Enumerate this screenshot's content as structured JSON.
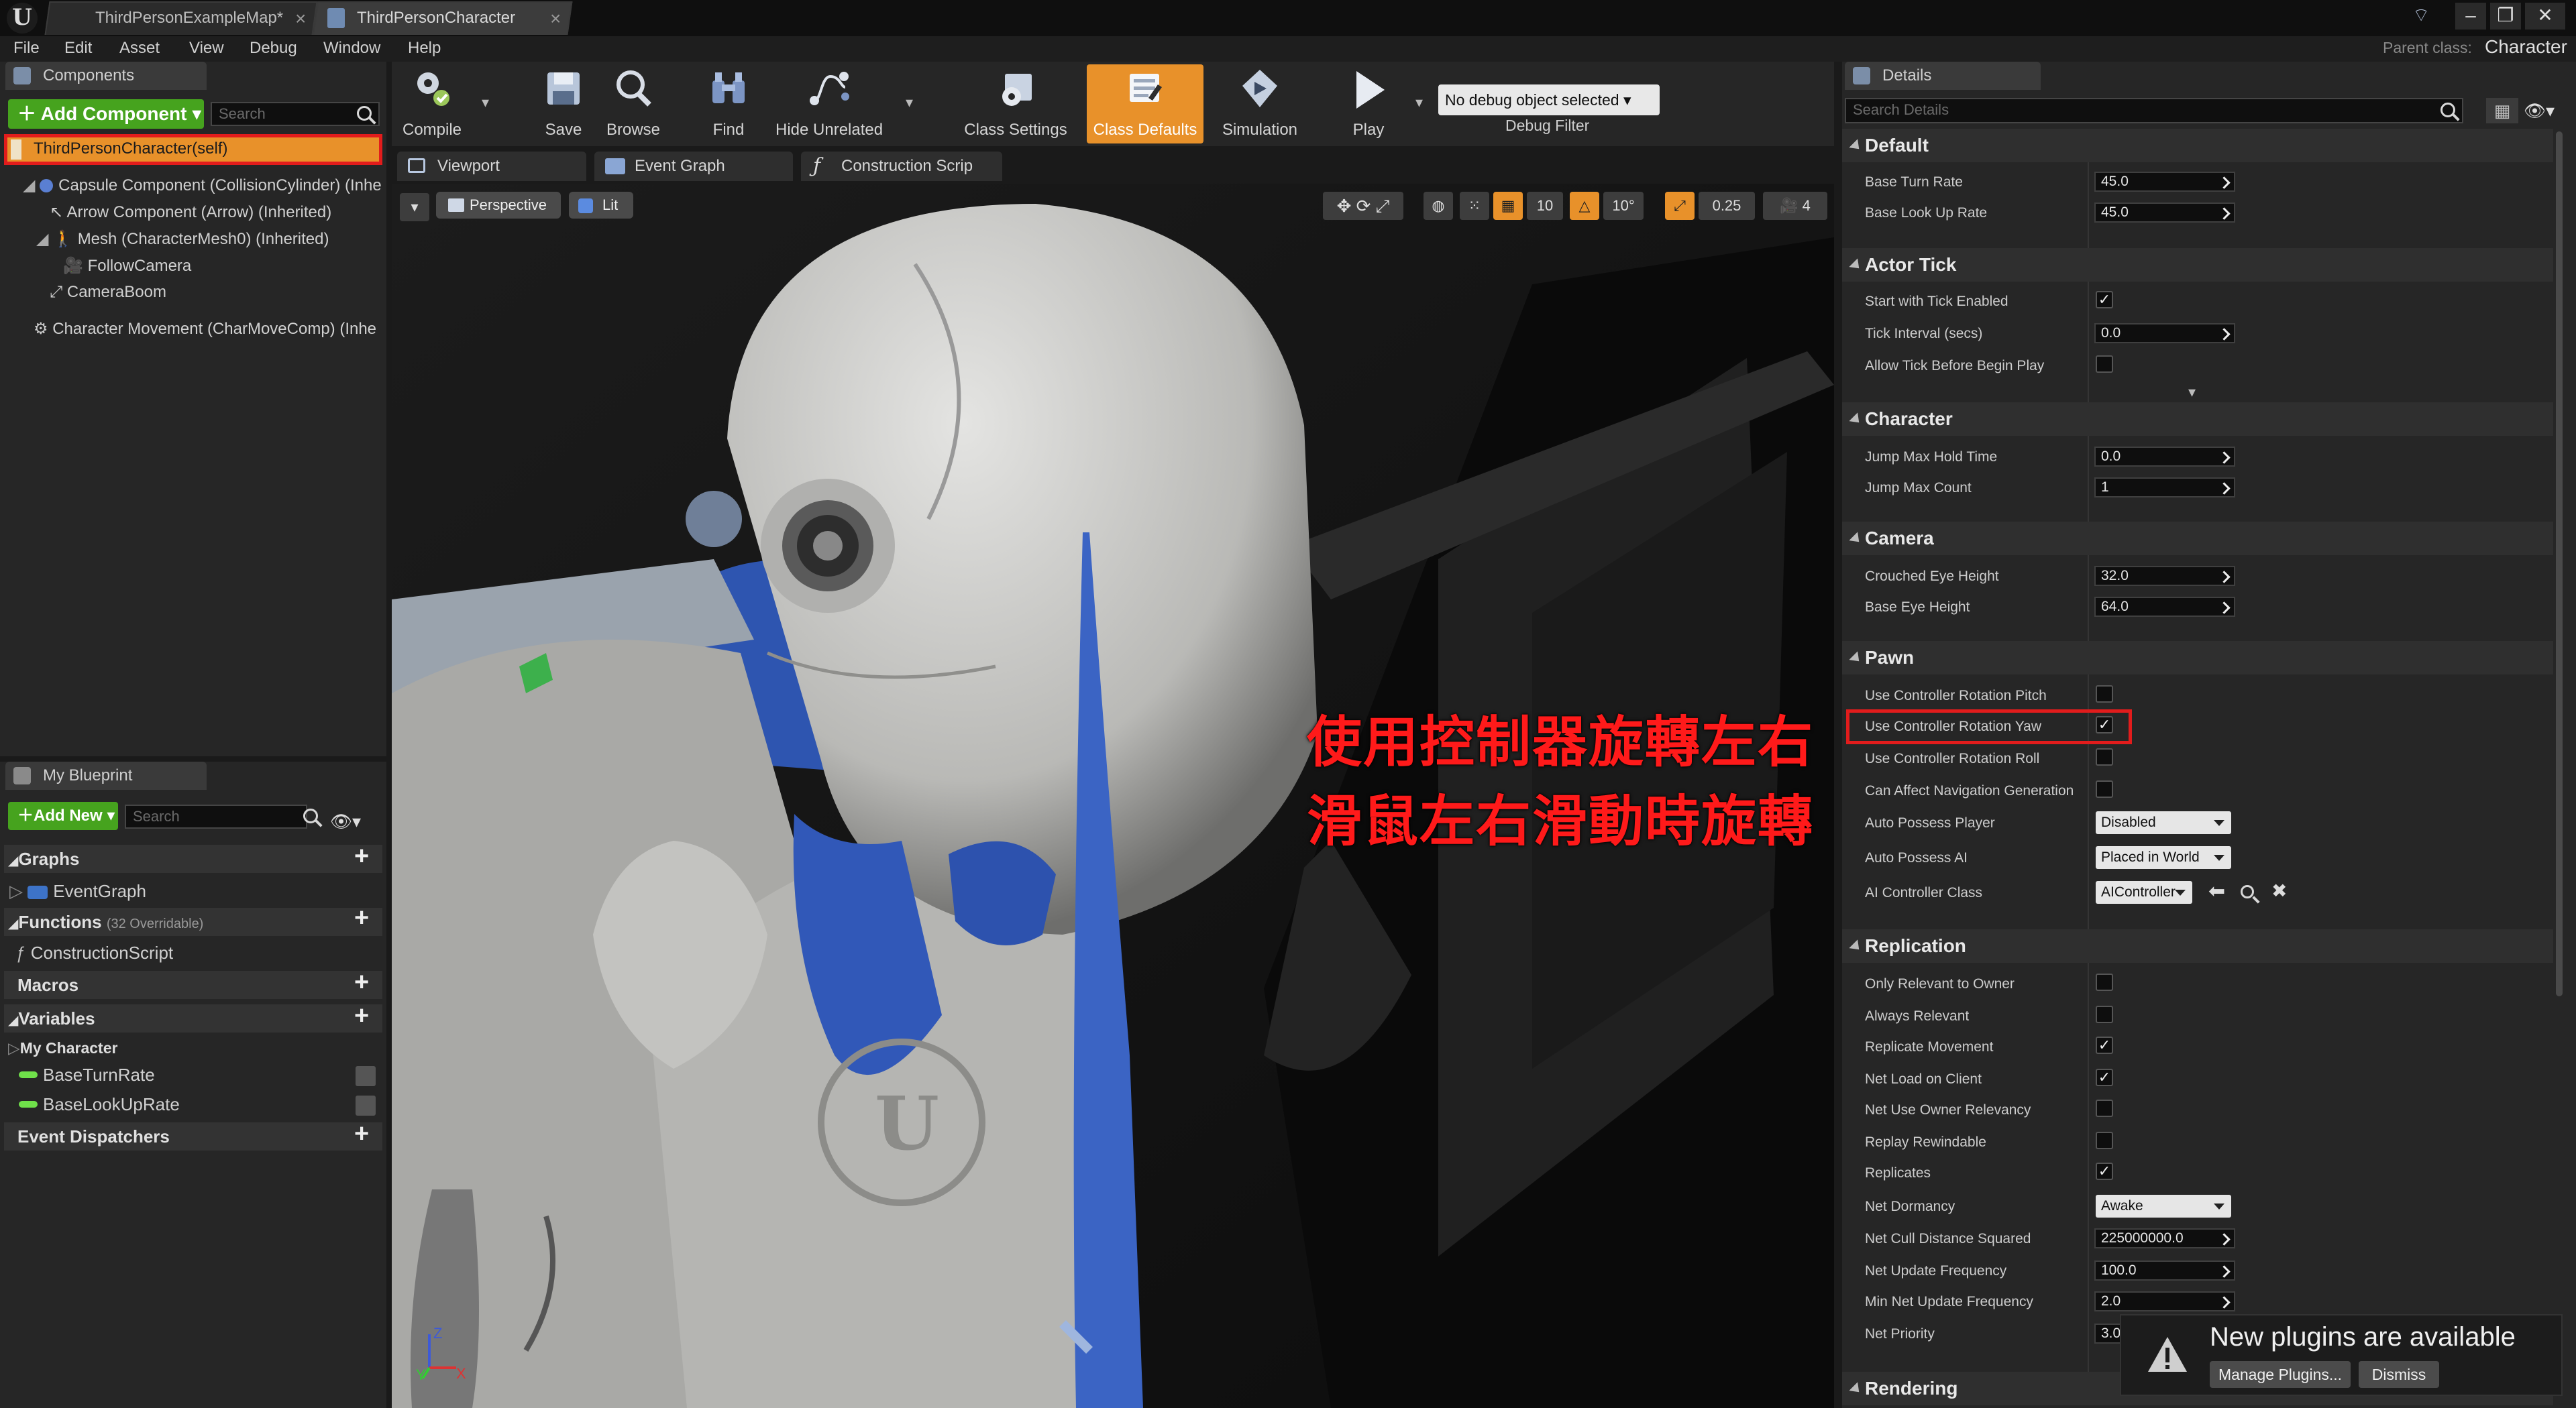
{
  "window": {
    "tabs": [
      "ThirdPersonExampleMap*",
      "ThirdPersonCharacter"
    ],
    "parent_class_label": "Parent class:",
    "parent_class_value": "Character"
  },
  "menu": [
    "File",
    "Edit",
    "Asset",
    "View",
    "Debug",
    "Window",
    "Help"
  ],
  "components": {
    "tab": "Components",
    "add_button": "Add Component",
    "search_placeholder": "Search",
    "items": [
      "ThirdPersonCharacter(self)",
      "Capsule Component (CollisionCylinder) (Inhe",
      "Arrow Component (Arrow) (Inherited)",
      "Mesh (CharacterMesh0) (Inherited)",
      "FollowCamera",
      "CameraBoom",
      "Character Movement (CharMoveComp) (Inhe"
    ]
  },
  "my_blueprint": {
    "tab": "My Blueprint",
    "add_button": "Add New",
    "search_placeholder": "Search",
    "graphs_label": "Graphs",
    "graph_item": "EventGraph",
    "functions_label": "Functions",
    "functions_note": "(32 Overridable)",
    "function_item": "ConstructionScript",
    "macros_label": "Macros",
    "variables_label": "Variables",
    "var_group": "My Character",
    "variables": [
      "BaseTurnRate",
      "BaseLookUpRate"
    ],
    "dispatchers_label": "Event Dispatchers"
  },
  "toolbar": {
    "compile": "Compile",
    "save": "Save",
    "browse": "Browse",
    "find": "Find",
    "hide_unrelated": "Hide Unrelated",
    "class_settings": "Class Settings",
    "class_defaults": "Class Defaults",
    "simulation": "Simulation",
    "play": "Play",
    "debug_select": "No debug object selected",
    "debug_filter": "Debug Filter"
  },
  "editor_tabs": [
    "Viewport",
    "Event Graph",
    "Construction Scrip"
  ],
  "viewport": {
    "perspective": "Perspective",
    "lit": "Lit",
    "grid_value": "10",
    "rot_value": "10°",
    "scale_value": "0.25",
    "cam_speed": "4",
    "annotation_line1": "使用控制器旋轉左右",
    "annotation_line2": "滑鼠左右滑動時旋轉"
  },
  "details": {
    "tab": "Details",
    "search_placeholder": "Search Details",
    "default": {
      "label": "Default",
      "base_turn_rate_label": "Base Turn Rate",
      "base_turn_rate": "45.0",
      "base_look_up_rate_label": "Base Look Up Rate",
      "base_look_up_rate": "45.0"
    },
    "actor_tick": {
      "label": "Actor Tick",
      "start_label": "Start with Tick Enabled",
      "interval_label": "Tick Interval (secs)",
      "interval": "0.0",
      "allow_label": "Allow Tick Before Begin Play"
    },
    "character": {
      "label": "Character",
      "jump_hold_label": "Jump Max Hold Time",
      "jump_hold": "0.0",
      "jump_count_label": "Jump Max Count",
      "jump_count": "1"
    },
    "camera": {
      "label": "Camera",
      "crouched_label": "Crouched Eye Height",
      "crouched": "32.0",
      "base_eye_label": "Base Eye Height",
      "base_eye": "64.0"
    },
    "pawn": {
      "label": "Pawn",
      "pitch_label": "Use Controller Rotation Pitch",
      "yaw_label": "Use Controller Rotation Yaw",
      "roll_label": "Use Controller Rotation Roll",
      "nav_label": "Can Affect Navigation Generation",
      "possess_player_label": "Auto Possess Player",
      "possess_player": "Disabled",
      "possess_ai_label": "Auto Possess AI",
      "possess_ai": "Placed in World",
      "ai_class_label": "AI Controller Class",
      "ai_class": "AIController"
    },
    "replication": {
      "label": "Replication",
      "owner_label": "Only Relevant to Owner",
      "always_label": "Always Relevant",
      "rep_move_label": "Replicate Movement",
      "net_load_label": "Net Load on Client",
      "net_use_label": "Net Use Owner Relevancy",
      "replay_label": "Replay Rewindable",
      "replicates_label": "Replicates",
      "dormancy_label": "Net Dormancy",
      "dormancy": "Awake",
      "cull_label": "Net Cull Distance Squared",
      "cull": "225000000.0",
      "update_label": "Net Update Frequency",
      "update": "100.0",
      "min_update_label": "Min Net Update Frequency",
      "min_update": "2.0",
      "priority_label": "Net Priority",
      "priority": "3.0"
    },
    "rendering": {
      "label": "Rendering"
    }
  },
  "notification": {
    "title": "New plugins are available",
    "manage": "Manage Plugins...",
    "dismiss": "Dismiss"
  },
  "colors": {
    "accent_orange": "#e8912a",
    "add_green": "#46a31e",
    "annotation_red": "#ff1a1a"
  }
}
